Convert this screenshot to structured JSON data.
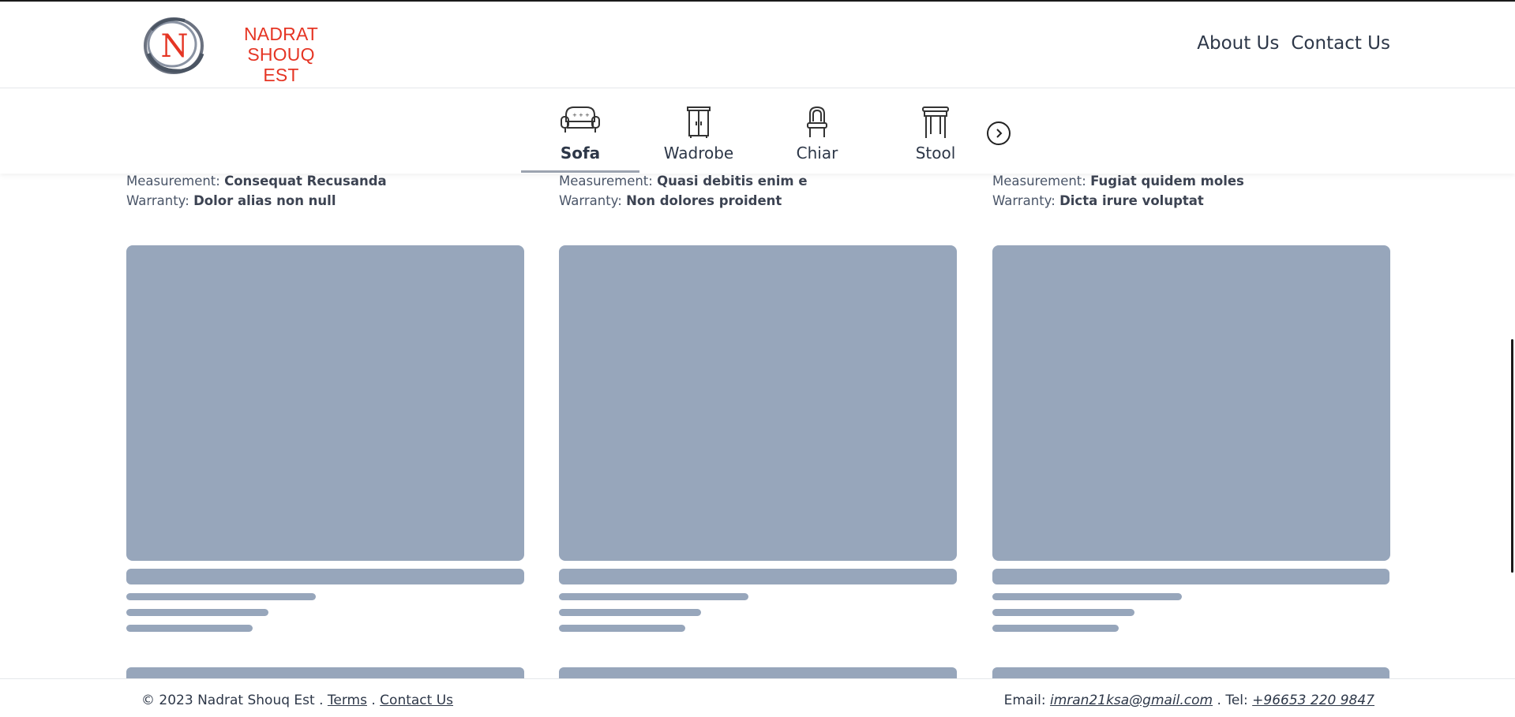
{
  "header": {
    "brand_line1": "NADRAT SHOUQ",
    "brand_line2": "EST",
    "logo_letter": "N",
    "nav": {
      "about": "About Us",
      "contact": "Contact Us"
    }
  },
  "categories": {
    "items": [
      {
        "label": "Sofa",
        "icon": "sofa-icon",
        "active": true
      },
      {
        "label": "Wadrobe",
        "icon": "wardrobe-icon",
        "active": false
      },
      {
        "label": "Chiar",
        "icon": "chair-icon",
        "active": false
      },
      {
        "label": "Stool",
        "icon": "stool-icon",
        "active": false
      }
    ],
    "next_icon": "chevron-right-icon"
  },
  "products": [
    {
      "measurement_label": "Measurement:",
      "measurement": "Consequat Recusanda",
      "warranty_label": "Warranty:",
      "warranty": "Dolor alias non null"
    },
    {
      "measurement_label": "Measurement:",
      "measurement": "Quasi debitis enim e",
      "warranty_label": "Warranty:",
      "warranty": "Non dolores proident"
    },
    {
      "measurement_label": "Measurement:",
      "measurement": "Fugiat quidem moles",
      "warranty_label": "Warranty:",
      "warranty": "Dicta irure voluptat"
    }
  ],
  "footer": {
    "copyright": "© 2023 Nadrat Shouq Est .",
    "terms": "Terms",
    "sep": ".",
    "contact": "Contact Us",
    "email_label": "Email:",
    "email": "imran21ksa@gmail.com",
    "tel_label": ". Tel:",
    "tel": "+96653 220 9847"
  },
  "colors": {
    "brand_red": "#e53524",
    "skeleton": "#97a6bb",
    "text": "#2d3748"
  }
}
